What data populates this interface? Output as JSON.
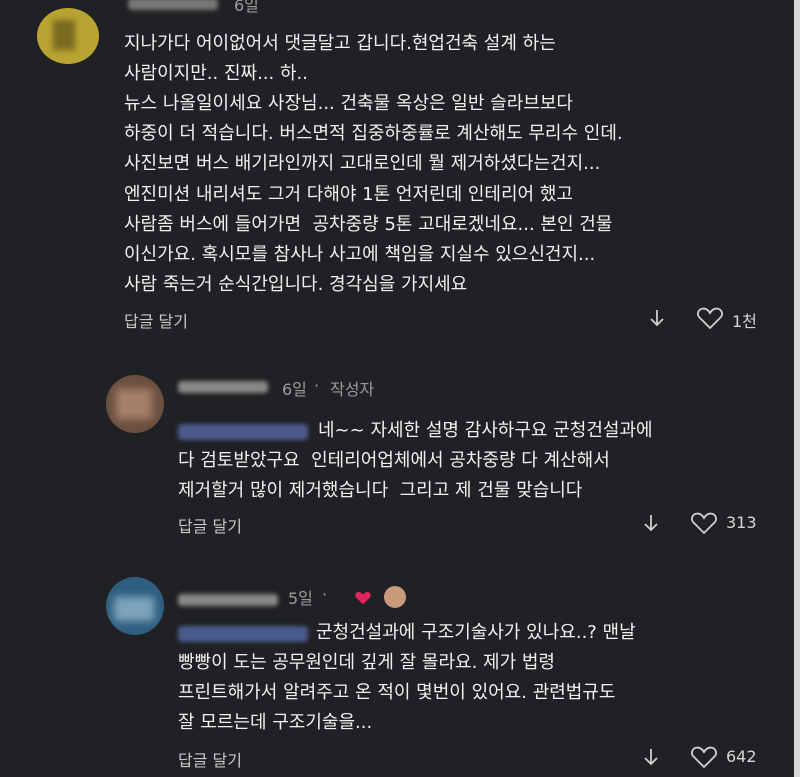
{
  "comments": [
    {
      "time": "6일",
      "lines": [
        "지나가다 어이없어서 댓글달고 갑니다.현업건축 설계 하는",
        "사람이지만.. 진짜... 하..",
        "뉴스 나올일이세요 사장님... 건축물 옥상은 일반 슬라브보다",
        "하중이 더 적습니다. 버스면적 집중하중률로 계산해도 무리수 인데.",
        "사진보면 버스 배기라인까지 고대로인데 뭘 제거하셨다는건지...",
        "엔진미션 내리셔도 그거 다해야 1톤 언저린데 인테리어 했고",
        "사람좀 버스에 들어가면  공차중량 5톤 고대로겠네요... 본인 건물",
        "이신가요. 혹시모를 참사나 사고에 책임을 지실수 있으신건지...",
        "사람 죽는거 순식간입니다. 경각심을 가지세요"
      ],
      "reply_label": "답글 달기",
      "likes": "1천"
    },
    {
      "time": "6일",
      "author_tag": "작성자",
      "lines": [
        "네~~ 자세한 설명 감사하구요 군청건설과에",
        "다 검토받았구요  인테리어업체에서 공차중량 다 계산해서",
        "제거할거 많이 제거했습니다  그리고 제 건물 맞습니다"
      ],
      "reply_label": "답글 달기",
      "likes": "313"
    },
    {
      "time": "5일",
      "lines": [
        "군청건설과에 구조기술사가 있나요..? 맨날",
        "빵빵이 도는 공무원인데 깊게 잘 몰라요. 제가 법령",
        "프린트해가서 알려주고 온 적이 몇번이 있어요. 관련법규도",
        "잘 모르는데 구조기술을..."
      ],
      "reply_label": "답글 달기",
      "likes": "642"
    }
  ],
  "icons": {
    "dislike": "arrow-down-icon",
    "like": "heart-outline-icon",
    "author_heart": "heart-filled-icon"
  },
  "colors": {
    "background": "#202124",
    "text": "#f0f0f0",
    "muted": "#9a9a9a",
    "heart": "#e0245e"
  }
}
